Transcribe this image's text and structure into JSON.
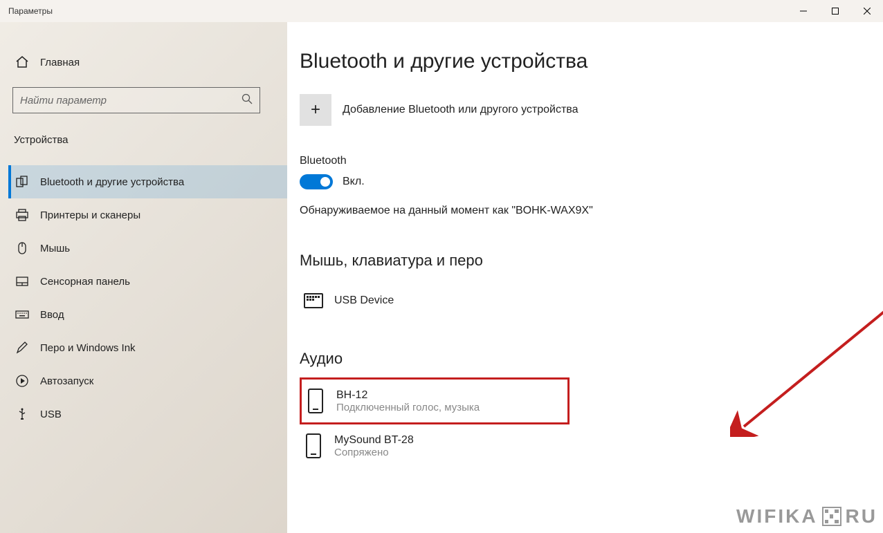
{
  "titlebar": {
    "title": "Параметры"
  },
  "sidebar": {
    "home_label": "Главная",
    "search_placeholder": "Найти параметр",
    "section_title": "Устройства",
    "items": [
      {
        "label": "Bluetooth и другие устройства"
      },
      {
        "label": "Принтеры и сканеры"
      },
      {
        "label": "Мышь"
      },
      {
        "label": "Сенсорная панель"
      },
      {
        "label": "Ввод"
      },
      {
        "label": "Перо и Windows Ink"
      },
      {
        "label": "Автозапуск"
      },
      {
        "label": "USB"
      }
    ]
  },
  "main": {
    "title": "Bluetooth и другие устройства",
    "add_device_label": "Добавление Bluetooth или другого устройства",
    "bluetooth_label": "Bluetooth",
    "toggle_state": "Вкл.",
    "discoverable_text": "Обнаруживаемое на данный момент как \"BOHK-WAX9X\"",
    "section_mouse": "Мышь, клавиатура и перо",
    "device_usb": "USB Device",
    "section_audio": "Аудио",
    "audio_devices": [
      {
        "name": "BH-12",
        "status": "Подключенный голос, музыка"
      },
      {
        "name": "MySound BT-28",
        "status": "Сопряжено"
      }
    ]
  },
  "watermark": {
    "text1": "WIFIKA",
    "text2": "RU"
  }
}
